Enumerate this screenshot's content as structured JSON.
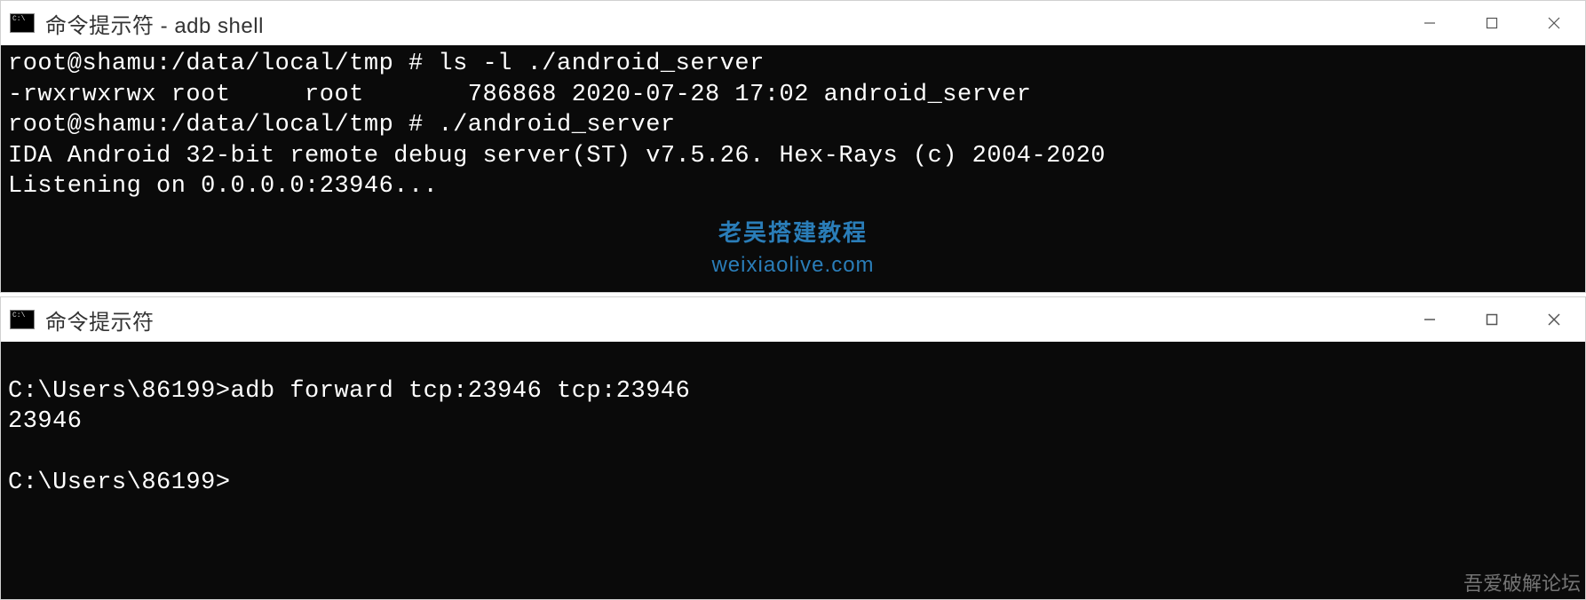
{
  "window1": {
    "title": "命令提示符 - adb  shell",
    "lines": [
      "root@shamu:/data/local/tmp # ls -l ./android_server",
      "-rwxrwxrwx root     root       786868 2020-07-28 17:02 android_server",
      "root@shamu:/data/local/tmp # ./android_server",
      "IDA Android 32-bit remote debug server(ST) v7.5.26. Hex-Rays (c) 2004-2020",
      "Listening on 0.0.0.0:23946..."
    ]
  },
  "window2": {
    "title": "命令提示符",
    "lines": [
      "",
      "C:\\Users\\86199>adb forward tcp:23946 tcp:23946",
      "23946",
      "",
      "C:\\Users\\86199>"
    ]
  },
  "watermark": {
    "cn": "老吴搭建教程",
    "url": "weixiaolive.com"
  },
  "corner": "吾爱破解论坛"
}
